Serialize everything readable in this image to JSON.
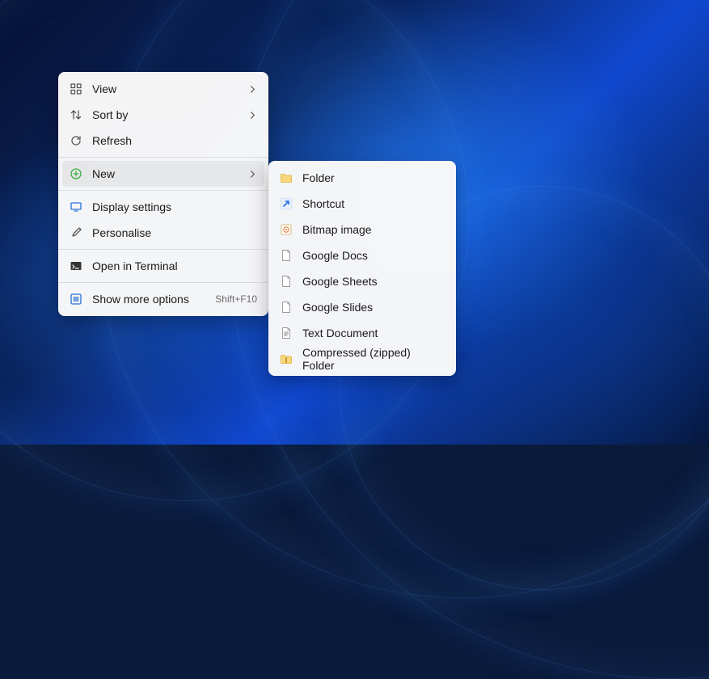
{
  "context_menu": {
    "view": "View",
    "sort_by": "Sort by",
    "refresh": "Refresh",
    "new": "New",
    "display_settings": "Display settings",
    "personalise": "Personalise",
    "open_in_terminal": "Open in Terminal",
    "show_more_options": "Show more options",
    "show_more_options_shortcut": "Shift+F10"
  },
  "new_submenu": {
    "folder": "Folder",
    "shortcut": "Shortcut",
    "bitmap_image": "Bitmap image",
    "google_docs": "Google Docs",
    "google_sheets": "Google Sheets",
    "google_slides": "Google Slides",
    "text_document": "Text Document",
    "compressed_zipped_folder": "Compressed (zipped) Folder"
  }
}
